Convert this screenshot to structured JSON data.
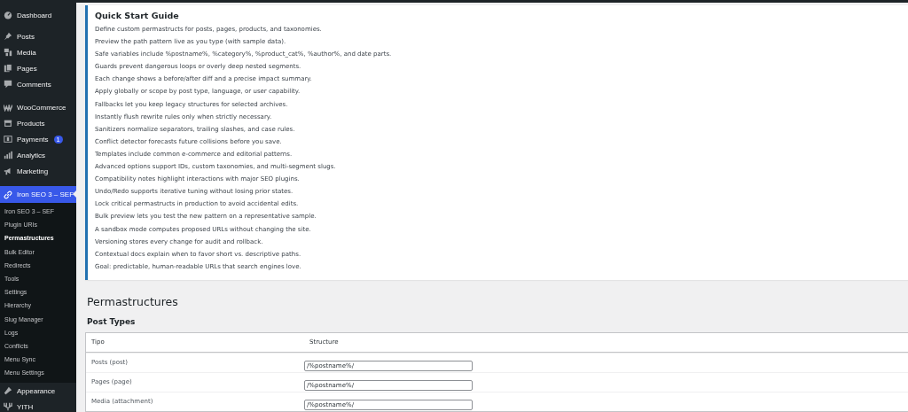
{
  "sidebar": {
    "menu": [
      {
        "label": "Dashboard",
        "selected": false
      },
      {
        "label": "Posts",
        "selected": false
      },
      {
        "label": "Media",
        "selected": false
      },
      {
        "label": "Pages",
        "selected": false
      },
      {
        "label": "Comments",
        "selected": false
      },
      {
        "label": "WooCommerce",
        "selected": false
      },
      {
        "label": "Products",
        "selected": false
      },
      {
        "label": "Payments",
        "selected": false,
        "badge": "1"
      },
      {
        "label": "Analytics",
        "selected": false
      },
      {
        "label": "Marketing",
        "selected": false
      },
      {
        "label": "Iron SEO 3 – SEF",
        "selected": true,
        "submenu": [
          {
            "label": "Iron SEO 3 – SEF",
            "selected": false
          },
          {
            "label": "Plugin URIs",
            "selected": false
          },
          {
            "label": "Permastructures",
            "selected": true
          },
          {
            "label": "Bulk Editor",
            "selected": false
          },
          {
            "label": "Redirects",
            "selected": false
          },
          {
            "label": "Tools",
            "selected": false
          },
          {
            "label": "Settings",
            "selected": false
          },
          {
            "label": "Hierarchy",
            "selected": false
          },
          {
            "label": "Slug Manager",
            "selected": false
          },
          {
            "label": "Logs",
            "selected": false
          },
          {
            "label": "Conflicts",
            "selected": false
          },
          {
            "label": "Menu Sync",
            "selected": false
          },
          {
            "label": "Menu Settings",
            "selected": false
          }
        ]
      },
      {
        "label": "Appearance",
        "selected": false
      },
      {
        "label": "YITH",
        "selected": false
      }
    ]
  },
  "notice": {
    "title": "Quick Start Guide",
    "lines": [
      "Define custom permastructs for posts, pages, products, and taxonomies.",
      "Preview the path pattern live as you type (with sample data).",
      "Safe variables include %postname%, %category%, %product_cat%, %author%, and date parts.",
      "Guards prevent dangerous loops or overly deep nested segments.",
      "Each change shows a before/after diff and a precise impact summary.",
      "Apply globally or scope by post type, language, or user capability.",
      "Fallbacks let you keep legacy structures for selected archives.",
      "Instantly flush rewrite rules only when strictly necessary.",
      "Sanitizers normalize separators, trailing slashes, and case rules.",
      "Conflict detector forecasts future collisions before you save.",
      "Templates include common e-commerce and editorial patterns.",
      "Advanced options support IDs, custom taxonomies, and multi-segment slugs.",
      "Compatibility notes highlight interactions with major SEO plugins.",
      "Undo/Redo supports iterative tuning without losing prior states.",
      "Lock critical permastructs in production to avoid accidental edits.",
      "Bulk preview lets you test the new pattern on a representative sample.",
      "A sandbox mode computes proposed URLs without changing the site.",
      "Versioning stores every change for audit and rollback.",
      "Contextual docs explain when to favor short vs. descriptive paths.",
      "Goal: predictable, human-readable URLs that search engines love."
    ]
  },
  "page": {
    "heading": "Permastructures",
    "section": "Post Types",
    "table": {
      "columns": [
        "Tipo",
        "Structure"
      ],
      "rows": [
        {
          "type": "Posts (post)",
          "structure": "/%postname%/"
        },
        {
          "type": "Pages (page)",
          "structure": "/%postname%/"
        },
        {
          "type": "Media (attachment)",
          "structure": "/%postname%/"
        }
      ]
    }
  }
}
